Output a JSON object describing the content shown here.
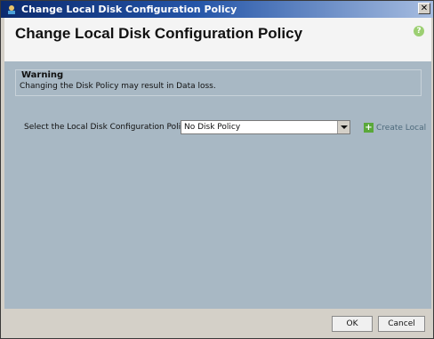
{
  "window": {
    "title": "Change Local Disk Configuration Policy",
    "close_glyph": "✕"
  },
  "header": {
    "title": "Change Local Disk Configuration Policy",
    "help_glyph": "?"
  },
  "warning": {
    "legend": "Warning",
    "message": "Changing the Disk Policy may result in Data loss."
  },
  "policy": {
    "label": "Select the Local Disk Configuration Policy:",
    "selected": "No Disk Policy"
  },
  "create_local": {
    "label": "Create Local"
  },
  "footer": {
    "ok_label": "OK",
    "cancel_label": "Cancel"
  },
  "icons": {
    "title": "app-icon",
    "help": "help-icon",
    "create": "plus-icon"
  }
}
